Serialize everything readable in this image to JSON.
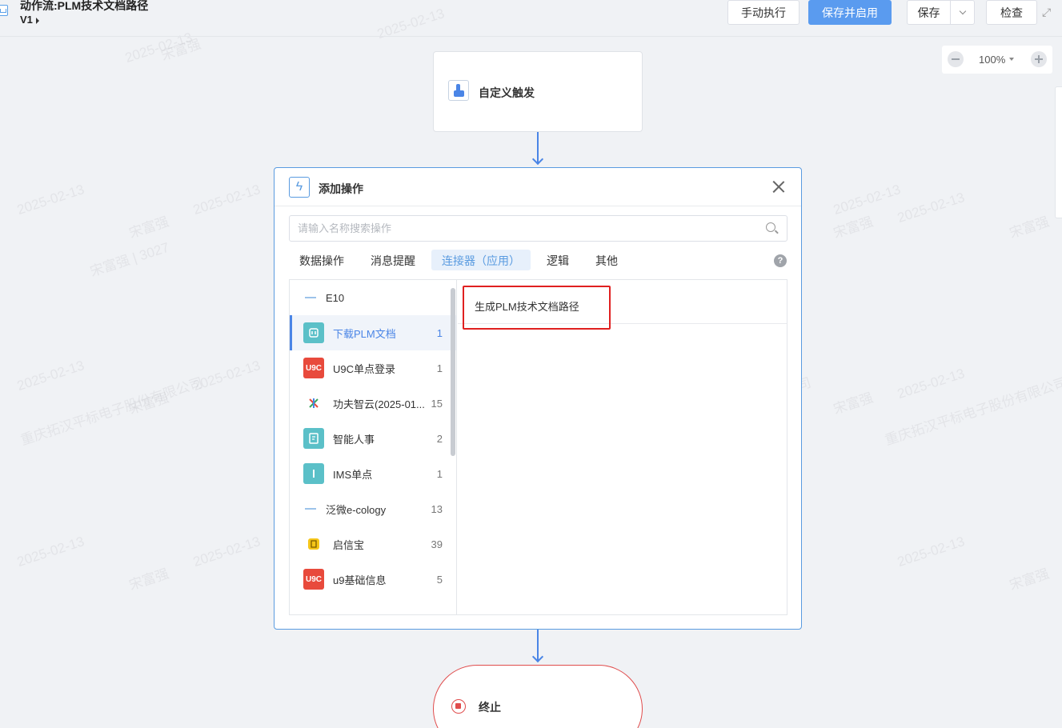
{
  "header": {
    "title": "动作流:PLM技术文档路径",
    "version": "V1",
    "buttons": {
      "manual_run": "手动执行",
      "save_enable": "保存并启用",
      "save": "保存",
      "check": "检查"
    }
  },
  "zoom": {
    "value": "100%"
  },
  "trigger": {
    "label": "自定义触发"
  },
  "dialog": {
    "title": "添加操作",
    "search_placeholder": "请输入名称搜索操作",
    "tabs": [
      "数据操作",
      "消息提醒",
      "连接器（应用）",
      "逻辑",
      "其他"
    ],
    "active_tab": 2,
    "connectors": [
      {
        "label": "E10",
        "count": "",
        "icon": "e10-logo"
      },
      {
        "label": "下载PLM文档",
        "count": "1",
        "icon": "plm-doc-icon",
        "color": "#5bc0c8"
      },
      {
        "label": "U9C单点登录",
        "count": "1",
        "icon": "u9c-logo",
        "color": "#e84a3c",
        "tag": "U9C"
      },
      {
        "label": "功夫智云(2025-01...",
        "count": "15",
        "icon": "kungfu-logo"
      },
      {
        "label": "智能人事",
        "count": "2",
        "icon": "hr-icon",
        "color": "#5bc0c8"
      },
      {
        "label": "IMS单点",
        "count": "1",
        "icon": "ims-icon",
        "color": "#5bc0c8"
      },
      {
        "label": "泛微e-cology",
        "count": "13",
        "icon": "ecology-logo"
      },
      {
        "label": "启信宝",
        "count": "39",
        "icon": "qixinbao-logo",
        "color": "#f5c518"
      },
      {
        "label": "u9基础信息",
        "count": "5",
        "icon": "u9-logo",
        "color": "#e84a3c",
        "tag": "U9C"
      }
    ],
    "operations": [
      {
        "label": "生成PLM技术文档路径"
      }
    ]
  },
  "end": {
    "label": "终止"
  },
  "watermark": {
    "date": "2025-02-13",
    "name": "宋富强",
    "id": "宋富强 | 3027",
    "company": "重庆拓汉平标电子股份有限公司"
  }
}
